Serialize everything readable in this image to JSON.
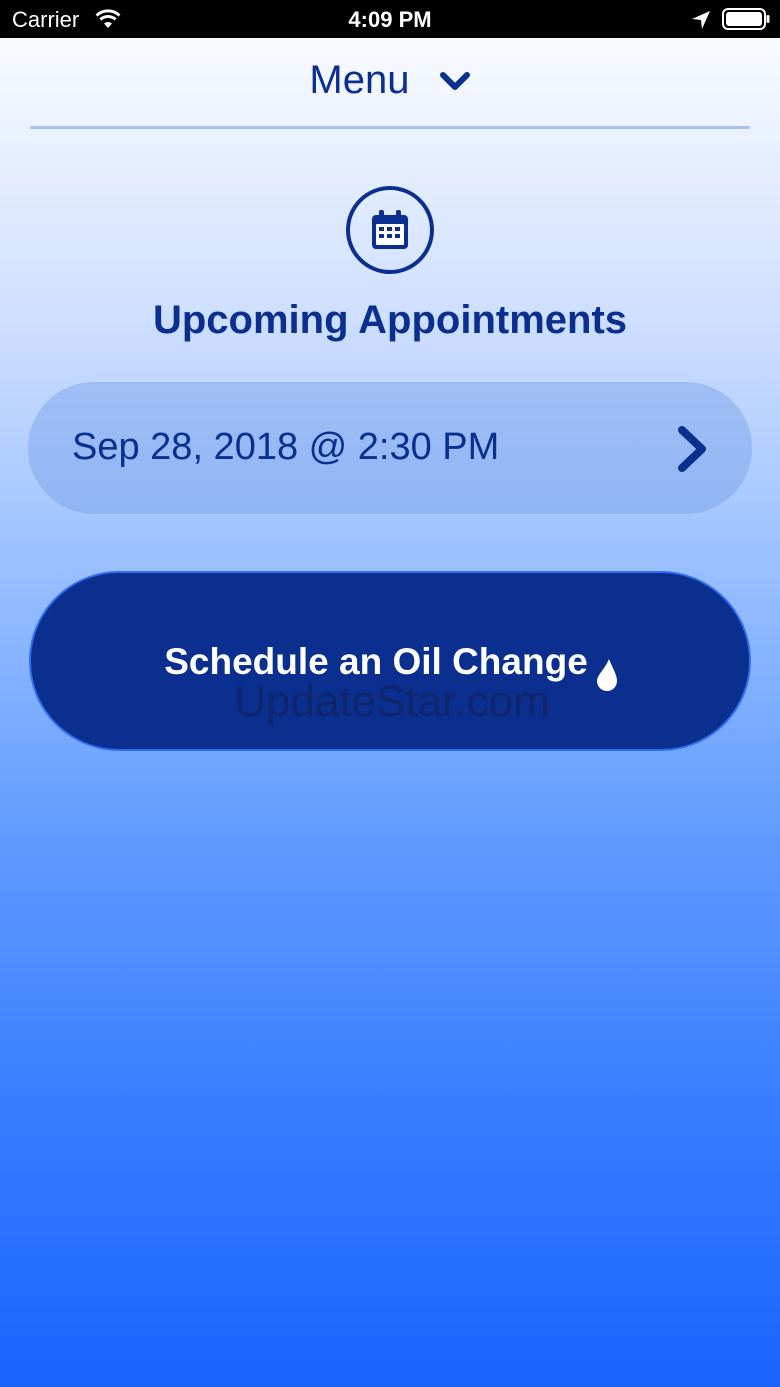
{
  "status_bar": {
    "carrier": "Carrier",
    "time": "4:09 PM"
  },
  "header": {
    "menu_label": "Menu"
  },
  "appointments": {
    "title": "Upcoming Appointments",
    "items": [
      {
        "label": "Sep 28, 2018 @ 2:30 PM"
      }
    ]
  },
  "schedule_button": {
    "label": "Schedule an Oil Change"
  },
  "watermark": "UpdateStar.com",
  "icons": {
    "menu": "chevron-down-icon",
    "section": "calendar-icon",
    "appointment": "chevron-right-icon",
    "schedule": "oil-drop-icon"
  },
  "colors": {
    "primary": "#0a2f8f",
    "button_bg": "#0a2f8f",
    "gradient_bottom": "#1a63ff"
  }
}
